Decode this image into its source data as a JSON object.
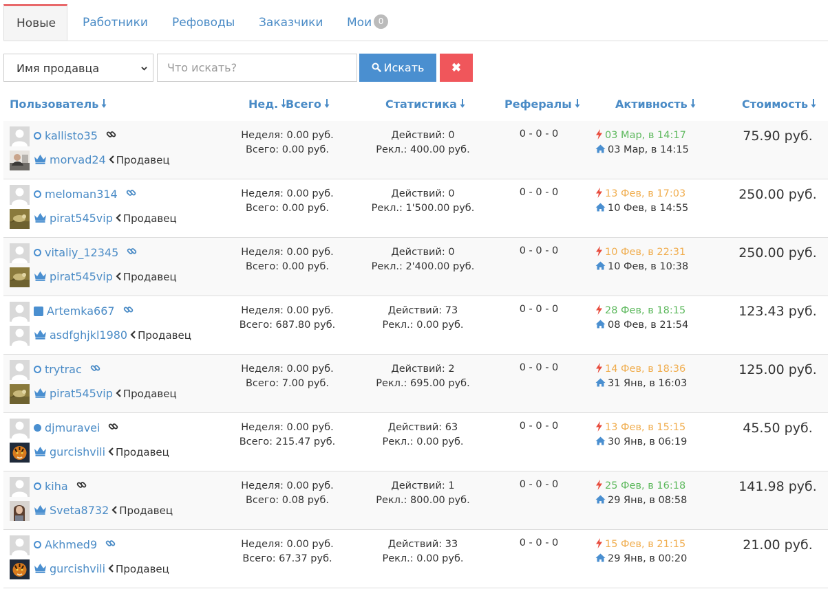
{
  "tabs": [
    {
      "label": "Новые",
      "active": true
    },
    {
      "label": "Работники"
    },
    {
      "label": "Рефоводы"
    },
    {
      "label": "Заказчики"
    },
    {
      "label": "Мои",
      "badge": "0"
    }
  ],
  "search": {
    "select_value": "Имя продавца",
    "placeholder": "Что искать?",
    "search_button": "Искать",
    "clear_icon": "✖"
  },
  "columns": {
    "user": "Пользователь",
    "week": "Нед.",
    "total": "Всего",
    "stats": "Статистика",
    "referrals": "Рефералы",
    "activity": "Активность",
    "price": "Стоимость"
  },
  "colors": {
    "link": "#4a8bc6",
    "primary": "#4a8fd0",
    "danger": "#f0565b",
    "active_tab_border": "#e8686a",
    "activity_green": "#5cb85c",
    "activity_orange": "#f0ad4e",
    "bolt": "#e84c3d"
  },
  "rows": [
    {
      "username": "kallisto35",
      "status": "empty",
      "link_color": "#333333",
      "seller": "morvad24",
      "seller_avatar": "photo-person",
      "role": "Продавец",
      "week": "Неделя: 0.00 руб.",
      "total": "Всего: 0.00 руб.",
      "actions": "Действий: 0",
      "ads": "Рекл.: 400.00 руб.",
      "referrals": "0 - 0 - 0",
      "last_active": "03 Мар, в 14:17",
      "last_active_color": "green",
      "registered": "03 Мар, в 14:15",
      "price": "75.90 руб."
    },
    {
      "username": "meloman314",
      "status": "empty",
      "link_color": "#4a8bc6",
      "seller": "pirat545vip",
      "seller_avatar": "photo-bird",
      "role": "Продавец",
      "week": "Неделя: 0.00 руб.",
      "total": "Всего: 0.00 руб.",
      "actions": "Действий: 0",
      "ads": "Рекл.: 1'500.00 руб.",
      "referrals": "0 - 0 - 0",
      "last_active": "13 Фев, в 17:03",
      "last_active_color": "orange",
      "registered": "10 Фев, в 14:55",
      "price": "250.00 руб."
    },
    {
      "username": "vitaliy_12345",
      "status": "empty",
      "link_color": "#4a8bc6",
      "seller": "pirat545vip",
      "seller_avatar": "photo-bird",
      "role": "Продавец",
      "week": "Неделя: 0.00 руб.",
      "total": "Всего: 0.00 руб.",
      "actions": "Действий: 0",
      "ads": "Рекл.: 2'400.00 руб.",
      "referrals": "0 - 0 - 0",
      "last_active": "10 Фев, в 22:31",
      "last_active_color": "orange",
      "registered": "10 Фев, в 10:38",
      "price": "250.00 руб."
    },
    {
      "username": "Artemka667",
      "status": "square",
      "link_color": "#4a8bc6",
      "seller": "asdfghjkl1980",
      "seller_avatar": "default",
      "role": "Продавец",
      "week": "Неделя: 0.00 руб.",
      "total": "Всего: 687.80 руб.",
      "actions": "Действий: 73",
      "ads": "Рекл.: 0.00 руб.",
      "referrals": "0 - 0 - 0",
      "last_active": "28 Фев, в 18:15",
      "last_active_color": "green",
      "registered": "08 Фев, в 21:54",
      "price": "123.43 руб."
    },
    {
      "username": "trytrac",
      "status": "empty",
      "link_color": "#4a8bc6",
      "seller": "pirat545vip",
      "seller_avatar": "photo-bird",
      "role": "Продавец",
      "week": "Неделя: 0.00 руб.",
      "total": "Всего: 7.00 руб.",
      "actions": "Действий: 2",
      "ads": "Рекл.: 695.00 руб.",
      "referrals": "0 - 0 - 0",
      "last_active": "14 Фев, в 18:36",
      "last_active_color": "orange",
      "registered": "31 Янв, в 16:03",
      "price": "125.00 руб."
    },
    {
      "username": "djmuravei",
      "status": "full",
      "link_color": "#333333",
      "seller": "gurcishvili",
      "seller_avatar": "photo-tiger",
      "role": "Продавец",
      "week": "Неделя: 0.00 руб.",
      "total": "Всего: 215.47 руб.",
      "actions": "Действий: 63",
      "ads": "Рекл.: 0.00 руб.",
      "referrals": "0 - 0 - 0",
      "last_active": "13 Фев, в 15:15",
      "last_active_color": "orange",
      "registered": "30 Янв, в 06:19",
      "price": "45.50 руб."
    },
    {
      "username": "kiha",
      "status": "empty",
      "link_color": "#333333",
      "seller": "Sveta8732",
      "seller_avatar": "photo-woman",
      "role": "Продавец",
      "week": "Неделя: 0.00 руб.",
      "total": "Всего: 0.08 руб.",
      "actions": "Действий: 1",
      "ads": "Рекл.: 800.00 руб.",
      "referrals": "0 - 0 - 0",
      "last_active": "25 Фев, в 16:18",
      "last_active_color": "green",
      "registered": "29 Янв, в 08:58",
      "price": "141.98 руб."
    },
    {
      "username": "Akhmed9",
      "status": "empty",
      "link_color": "#4a8bc6",
      "seller": "gurcishvili",
      "seller_avatar": "photo-tiger",
      "role": "Продавец",
      "week": "Неделя: 0.00 руб.",
      "total": "Всего: 67.37 руб.",
      "actions": "Действий: 33",
      "ads": "Рекл.: 0.00 руб.",
      "referrals": "0 - 0 - 0",
      "last_active": "15 Фев, в 21:15",
      "last_active_color": "orange",
      "registered": "29 Янв, в 00:20",
      "price": "21.00 руб."
    }
  ]
}
